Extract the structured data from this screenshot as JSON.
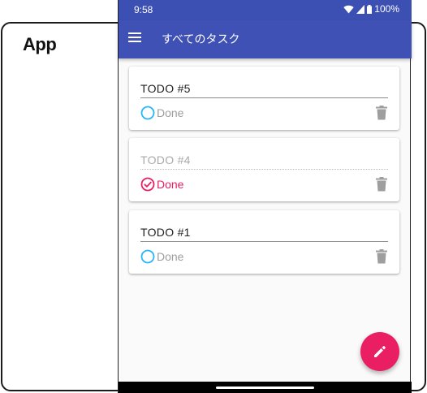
{
  "outer": {
    "label": "App"
  },
  "status_bar": {
    "time": "9:58",
    "battery": "100%"
  },
  "app_bar": {
    "title": "すべてのタスク",
    "menu_icon": "hamburger-menu-icon"
  },
  "todos": [
    {
      "text": "TODO #5",
      "done": false,
      "done_label": "Done"
    },
    {
      "text": "TODO #4",
      "done": true,
      "done_label": "Done"
    },
    {
      "text": "TODO #1",
      "done": false,
      "done_label": "Done"
    }
  ],
  "fab": {
    "icon": "pencil-icon"
  },
  "colors": {
    "primary": "#3f51b5",
    "accent": "#e91e63",
    "circle_unchecked": "#29b6f6",
    "trash": "#9e9e9e"
  }
}
